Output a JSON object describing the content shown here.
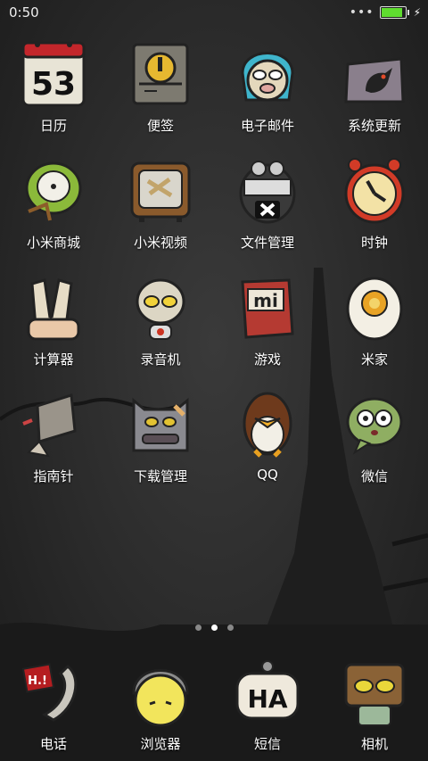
{
  "status_bar": {
    "time": "0:50",
    "more": "•••",
    "battery_level": 0.9,
    "charging_icon": "bolt-icon"
  },
  "apps": [
    {
      "label": "日历",
      "icon": "calendar-icon",
      "text": "53"
    },
    {
      "label": "便签",
      "icon": "notes-icon"
    },
    {
      "label": "电子邮件",
      "icon": "email-icon"
    },
    {
      "label": "系统更新",
      "icon": "system-update-icon"
    },
    {
      "label": "小米商城",
      "icon": "mi-store-icon"
    },
    {
      "label": "小米视频",
      "icon": "mi-video-icon"
    },
    {
      "label": "文件管理",
      "icon": "file-manager-icon"
    },
    {
      "label": "时钟",
      "icon": "clock-icon"
    },
    {
      "label": "计算器",
      "icon": "calculator-icon"
    },
    {
      "label": "录音机",
      "icon": "recorder-icon"
    },
    {
      "label": "游戏",
      "icon": "games-icon",
      "text": "mi"
    },
    {
      "label": "米家",
      "icon": "mijia-icon"
    },
    {
      "label": "指南针",
      "icon": "compass-icon"
    },
    {
      "label": "下载管理",
      "icon": "downloads-icon"
    },
    {
      "label": "QQ",
      "icon": "qq-icon"
    },
    {
      "label": "微信",
      "icon": "wechat-icon"
    }
  ],
  "page_indicator": {
    "count": 3,
    "active": 2
  },
  "dock": [
    {
      "label": "电话",
      "icon": "phone-icon",
      "text": "H.!"
    },
    {
      "label": "浏览器",
      "icon": "browser-icon"
    },
    {
      "label": "短信",
      "icon": "messages-icon",
      "text": "HA"
    },
    {
      "label": "相机",
      "icon": "camera-icon"
    }
  ]
}
